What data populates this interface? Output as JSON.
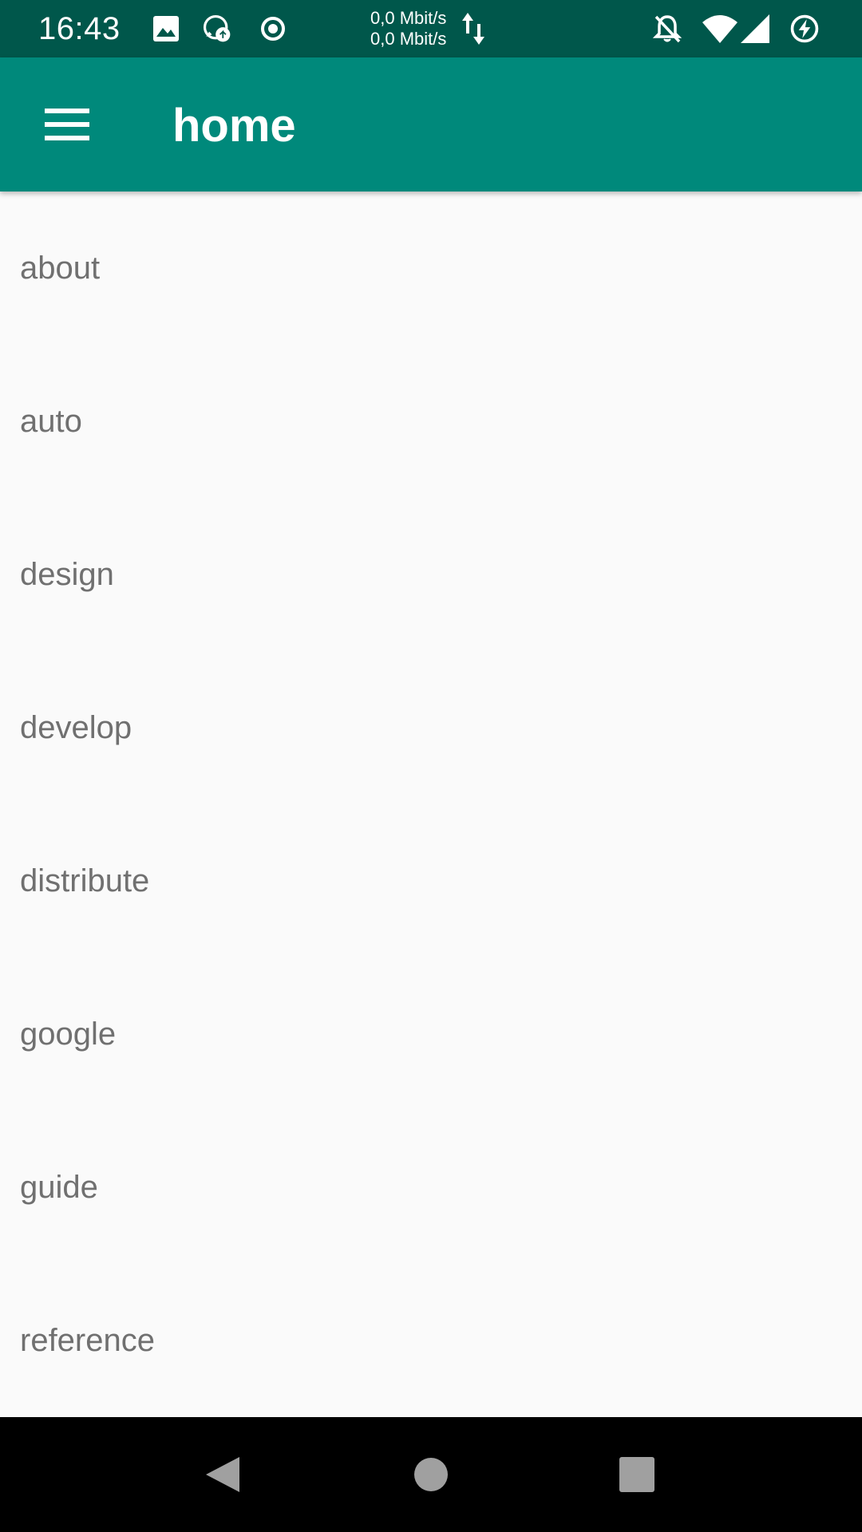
{
  "status_bar": {
    "time": "16:43",
    "net_up": "0,0 Mbit/s",
    "net_down": "0,0 Mbit/s",
    "icons": [
      "image-icon",
      "whatsapp-icon",
      "record-icon",
      "data-arrows-icon",
      "notifications-off-icon",
      "wifi-icon",
      "signal-icon",
      "battery-charging-icon"
    ]
  },
  "app_bar": {
    "title": "home",
    "menu_icon": "hamburger-menu-icon",
    "background": "#00897B"
  },
  "list": {
    "items": [
      {
        "label": "about"
      },
      {
        "label": "auto"
      },
      {
        "label": "design"
      },
      {
        "label": "develop"
      },
      {
        "label": "distribute"
      },
      {
        "label": "google"
      },
      {
        "label": "guide"
      },
      {
        "label": "reference"
      }
    ]
  },
  "nav_bar": {
    "buttons": [
      "back-icon",
      "home-icon",
      "recents-icon"
    ]
  },
  "colors": {
    "status_bar": "#00574B",
    "app_bar": "#00897B",
    "text_secondary": "#707070",
    "background": "#FAFAFA"
  }
}
